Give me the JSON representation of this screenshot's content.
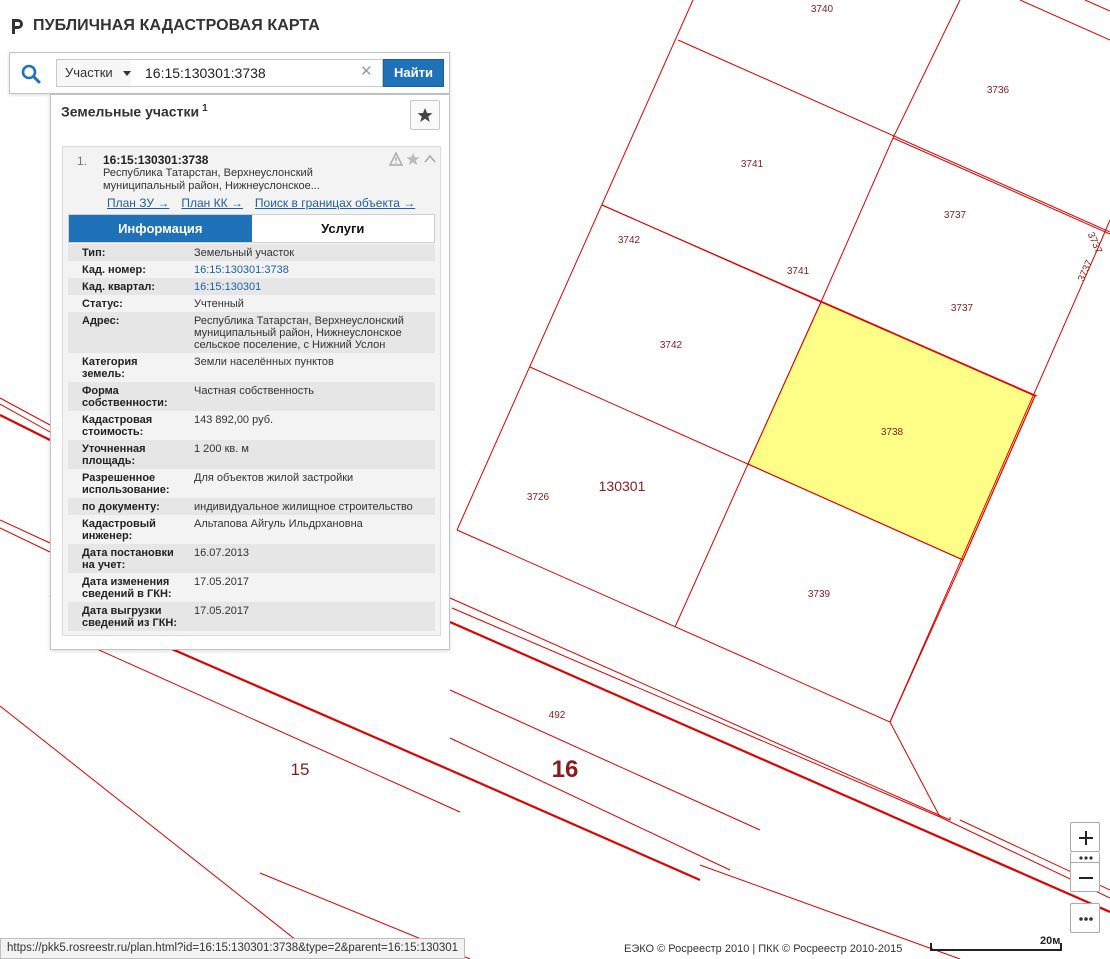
{
  "header": {
    "title": "ПУБЛИЧНАЯ КАДАСТРОВАЯ КАРТА"
  },
  "search": {
    "type_label": "Участки",
    "value": "16:15:130301:3738",
    "button_label": "Найти"
  },
  "results": {
    "heading": "Земельные участки",
    "count": "1",
    "item": {
      "index": "1.",
      "cad_number": "16:15:130301:3738",
      "address_short": "Республика Татарстан, Верхнеуслонский муниципальный район, Нижнеуслонское...",
      "links": [
        "План ЗУ →",
        "План КК →",
        "Поиск в границах объекта →"
      ],
      "tabs": [
        "Информация",
        "Услуги"
      ],
      "info": [
        {
          "key": "Тип:",
          "value": "Земельный участок"
        },
        {
          "key": "Кад. номер:",
          "value": "16:15:130301:3738"
        },
        {
          "key": "Кад. квартал:",
          "value": "16:15:130301"
        },
        {
          "key": "Статус:",
          "value": "Учтенный"
        },
        {
          "key": "Адрес:",
          "value": "Республика Татарстан, Верхнеуслонский муниципальный район, Нижнеуслонское сельское поселение, с Нижний Услон"
        },
        {
          "key": "Категория земель:",
          "value": "Земли населённых пунктов"
        },
        {
          "key": "Форма собственности:",
          "value": "Частная собственность"
        },
        {
          "key": "Кадастровая стоимость:",
          "value": "143 892,00 руб."
        },
        {
          "key": "Уточненная площадь:",
          "value": "1 200 кв. м"
        },
        {
          "key": "Разрешенное использование:",
          "value": "Для объектов жилой застройки"
        },
        {
          "key": "по документу:",
          "value": "индивидуальное жилищное строительство"
        },
        {
          "key": "Кадастровый инженер:",
          "value": "Альтапова Айгуль Ильдрхановна"
        },
        {
          "key": "Дата постановки на учет:",
          "value": "16.07.2013"
        },
        {
          "key": "Дата изменения сведений в ГКН:",
          "value": "17.05.2017"
        },
        {
          "key": "Дата выгрузки сведений из ГКН:",
          "value": "17.05.2017"
        }
      ]
    }
  },
  "map": {
    "parcel_labels": [
      "3740",
      "3736",
      "3741",
      "3737",
      "3742",
      "3741",
      "3737",
      "3737",
      "3737",
      "3742",
      "3738",
      "3726",
      "3739",
      "492"
    ],
    "quarter_label": "130301",
    "district_labels": [
      "15",
      "16"
    ],
    "highlight_color": "#ffff88",
    "boundary_color": "#e00000",
    "label_color": "#8b1a1a"
  },
  "controls": {
    "zoom_in": "+",
    "zoom_out": "−",
    "more": "•••"
  },
  "footer": {
    "status_url": "https://pkk5.rosreestr.ru/plan.html?id=16:15:130301:3738&type=2&parent=16:15:130301",
    "attribution": "ЕЭКО © Росреестр 2010 | ПКК © Росреестр 2010-2015",
    "scale": "20м"
  }
}
